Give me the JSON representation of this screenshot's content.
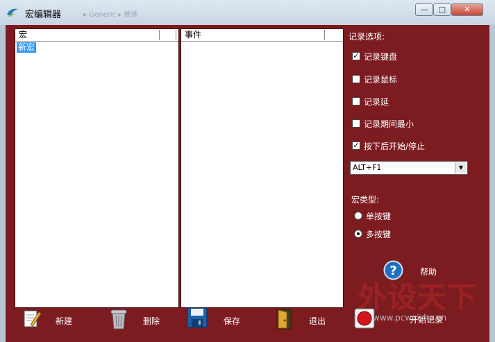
{
  "window": {
    "title": "宏编辑器",
    "breadcrumb": "▸ Generic ▸ 被选",
    "controls": {
      "minimize": "—",
      "maximize": "□",
      "close": "✕"
    }
  },
  "macro_list": {
    "header": "宏",
    "items": [
      "新宏"
    ]
  },
  "event_list": {
    "header": "事件"
  },
  "record_options": {
    "heading": "记录选项:",
    "options": [
      {
        "label": "记录键盘",
        "checked": true
      },
      {
        "label": "记录鼠标",
        "checked": false
      },
      {
        "label": "记录延",
        "checked": false
      },
      {
        "label": "记录期间最小",
        "checked": false
      },
      {
        "label": "按下后开始/停止",
        "checked": true
      }
    ],
    "hotkey": "ALT+F1"
  },
  "macro_type": {
    "heading": "宏类型:",
    "options": [
      {
        "label": "单按键",
        "selected": false
      },
      {
        "label": "多按键",
        "selected": true
      }
    ]
  },
  "help": {
    "label": "帮助",
    "icon": "help-icon"
  },
  "toolbar": {
    "new_label": "新建",
    "delete_label": "删除",
    "save_label": "保存",
    "exit_label": "退出",
    "record_label": "开始记录"
  },
  "watermark": {
    "text": "外设天下",
    "url": "www.pcwaishe.cn"
  },
  "colors": {
    "background": "#7c1b20",
    "selection": "#3399ff",
    "help_blue": "#1f6fc0"
  }
}
